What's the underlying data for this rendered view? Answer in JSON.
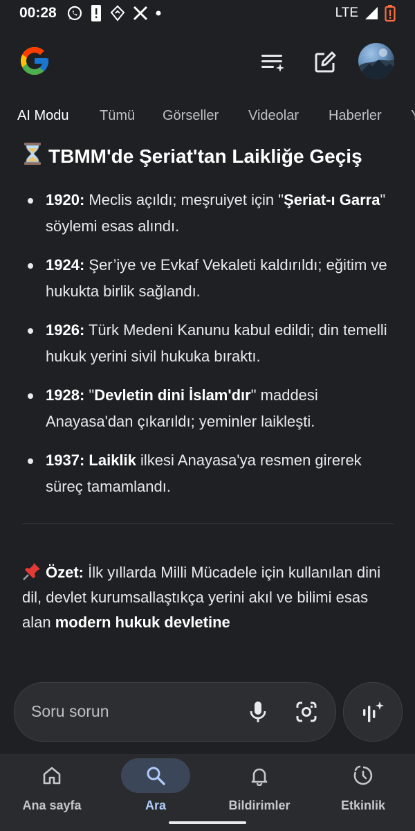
{
  "status_bar": {
    "time": "00:28",
    "network": "LTE",
    "left_icons": [
      "whatsapp-icon",
      "alert-icon",
      "notification-icon",
      "x-icon",
      "dot-icon"
    ],
    "right_icons": [
      "signal-icon",
      "battery-low-icon"
    ]
  },
  "header": {
    "logo": "google-g-logo",
    "actions": [
      "history-sparkle-icon",
      "edit-icon",
      "avatar"
    ]
  },
  "tabs": [
    "AI Modu",
    "Tümü",
    "Görseller",
    "Videolar",
    "Haberler",
    "Y"
  ],
  "tabs_active_index": 0,
  "content": {
    "title": "TBMM'de Şeriat'tan Laikliğe Geçiş",
    "items": [
      {
        "year": "1920:",
        "pre": " Meclis açıldı; meşruiyet için \"",
        "bold": "Şeriat-ı Garra",
        "post": "\" söylemi esas alındı."
      },
      {
        "year": "1924:",
        "pre": " Şer’iye ve Evkaf Vekaleti kaldırıldı; eğitim ve hukukta birlik sağlandı.",
        "bold": "",
        "post": ""
      },
      {
        "year": "1926:",
        "pre": " Türk Medeni Kanunu kabul edildi; din temelli hukuk yerini sivil hukuka bıraktı.",
        "bold": "",
        "post": ""
      },
      {
        "year": "1928:",
        "pre": " \"",
        "bold": "Devletin dini İslam'dır",
        "post": "\" maddesi Anayasa'dan çıkarıldı; yeminler laikleşti."
      },
      {
        "year": "1937:",
        "pre": " ",
        "bold": "Laiklik",
        "post": " ilkesi Anayasa'ya resmen girerek süreç tamamlandı."
      }
    ],
    "summary": {
      "label": "Özet:",
      "text": " İlk yıllarda Milli Mücadele için kullanılan dini dil, devlet kurumsallaştıkça yerini akıl ve bilimi esas alan ",
      "bold_end": "modern hukuk devletine"
    }
  },
  "ask": {
    "placeholder": "Soru sorun"
  },
  "bottom_nav": [
    {
      "label": "Ana sayfa",
      "icon": "home-icon"
    },
    {
      "label": "Ara",
      "icon": "search-icon"
    },
    {
      "label": "Bildirimler",
      "icon": "bell-icon"
    },
    {
      "label": "Etkinlik",
      "icon": "activity-icon"
    }
  ],
  "bottom_nav_active_index": 1,
  "colors": {
    "background": "#1f2024",
    "text": "#e8eaed",
    "nav_active_pill": "#3b4658",
    "nav_active_text": "#aecbfa"
  }
}
